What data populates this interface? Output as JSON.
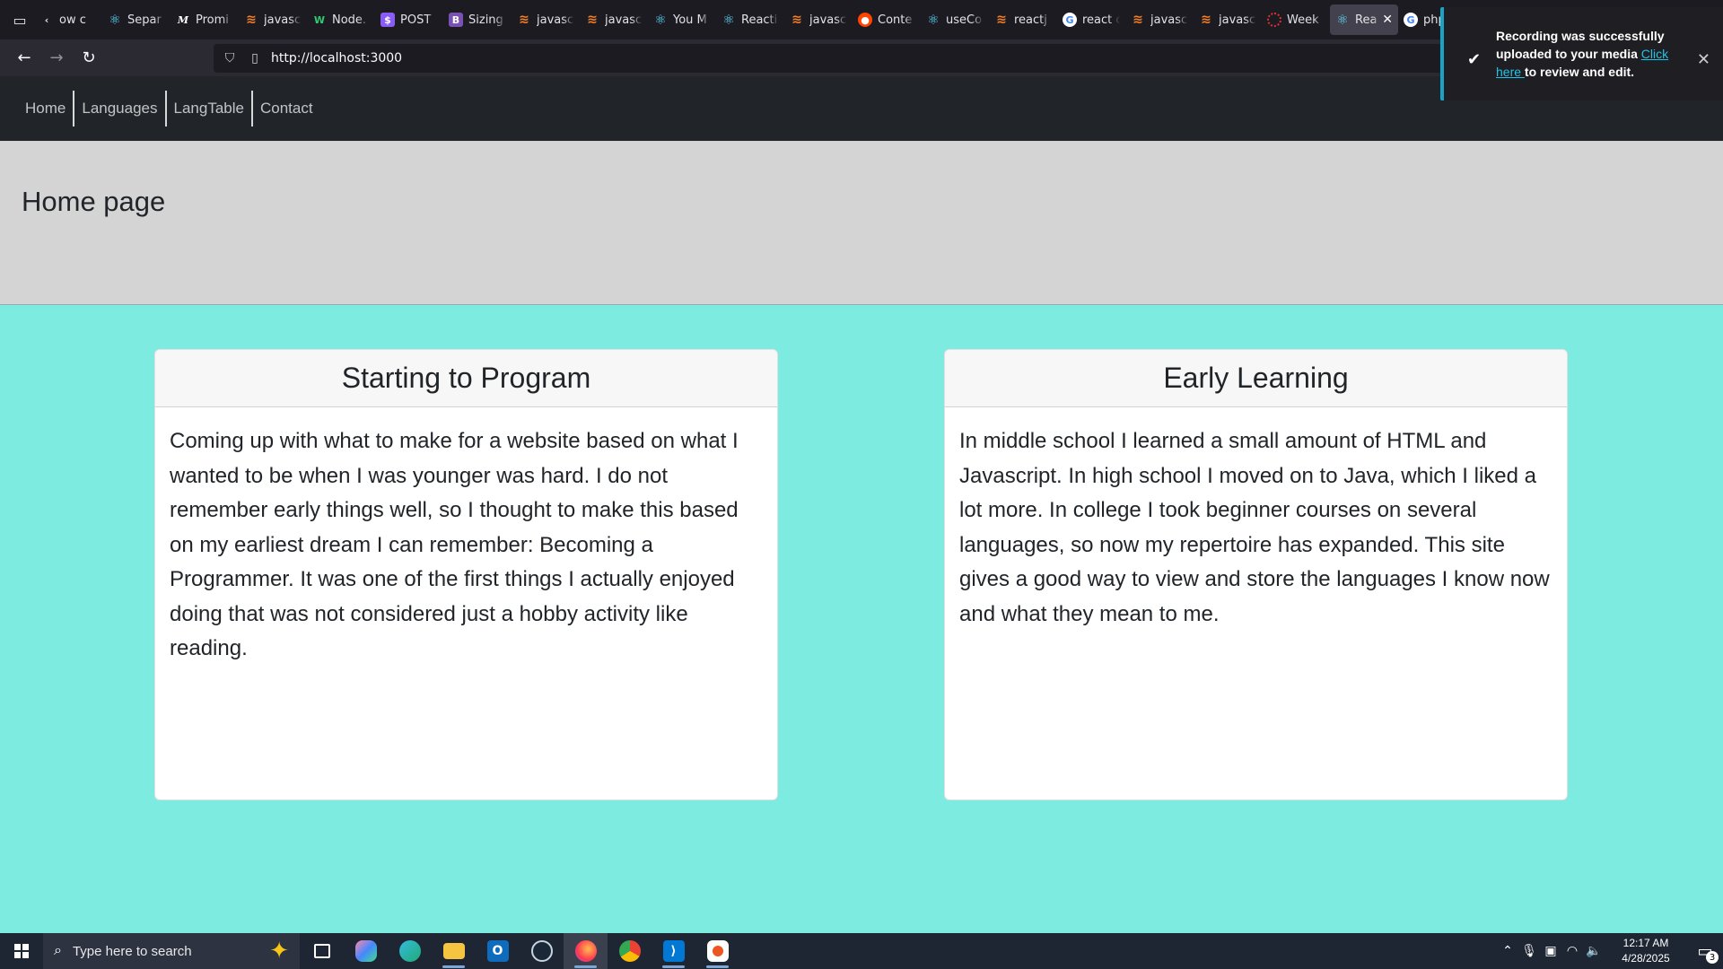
{
  "browser": {
    "tabs": [
      {
        "fav": "‹",
        "favclass": "",
        "title": "ow c"
      },
      {
        "fav": "⚛",
        "favclass": "fav-react",
        "title": "Separ"
      },
      {
        "fav": "M",
        "favclass": "fav-m",
        "title": "Promi"
      },
      {
        "fav": "≋",
        "favclass": "fav-so",
        "title": "javasc"
      },
      {
        "fav": "W",
        "favclass": "fav-w",
        "title": "Node."
      },
      {
        "fav": "$",
        "favclass": "fav-s",
        "title": "POST"
      },
      {
        "fav": "B",
        "favclass": "fav-b",
        "title": "Sizing"
      },
      {
        "fav": "≋",
        "favclass": "fav-so",
        "title": "javasc"
      },
      {
        "fav": "≋",
        "favclass": "fav-so",
        "title": "javasc"
      },
      {
        "fav": "⚛",
        "favclass": "fav-react",
        "title": "You M"
      },
      {
        "fav": "⚛",
        "favclass": "fav-react",
        "title": "Reacti"
      },
      {
        "fav": "≋",
        "favclass": "fav-so",
        "title": "javasc"
      },
      {
        "fav": "●",
        "favclass": "fav-r",
        "title": "Conte"
      },
      {
        "fav": "⚛",
        "favclass": "fav-react",
        "title": "useCo"
      },
      {
        "fav": "≋",
        "favclass": "fav-so",
        "title": "reactj"
      },
      {
        "fav": "G",
        "favclass": "fav-g",
        "title": "react c"
      },
      {
        "fav": "≋",
        "favclass": "fav-so",
        "title": "javasc"
      },
      {
        "fav": "≋",
        "favclass": "fav-so",
        "title": "javasc"
      },
      {
        "fav": "",
        "favclass": "fav-ring",
        "title": "Week"
      },
      {
        "fav": "⚛",
        "favclass": "fav-react",
        "title": "Rea",
        "active": true
      },
      {
        "fav": "G",
        "favclass": "fav-g",
        "title": "php"
      }
    ],
    "active_tab_close": "✕",
    "url": "http://localhost:3000"
  },
  "site": {
    "nav": [
      "Home",
      "Languages",
      "LangTable",
      "Contact"
    ],
    "page_title": "Home page",
    "cards": [
      {
        "title": "Starting to Program",
        "body": "Coming up with what to make for a website based on what I wanted to be when I was younger was hard. I do not remember early things well, so I thought to make this based on my earliest dream I can remember: Becoming a Programmer. It was one of the first things I actually enjoyed doing that was not considered just a hobby activity like reading."
      },
      {
        "title": "Early Learning",
        "body": "In middle school I learned a small amount of HTML and Javascript. In high school I moved on to Java, which I liked a lot more. In college I took beginner courses on several languages, so now my repertoire has expanded. This site gives a good way to view and store the languages I know now and what they mean to me."
      }
    ]
  },
  "toast": {
    "message_a": "Recording was successfully uploaded to your media ",
    "link": "Click here ",
    "message_b": "to review and edit."
  },
  "taskbar": {
    "search_placeholder": "Type here to search",
    "time": "12:17 AM",
    "date": "4/28/2025",
    "notification_count": "3"
  },
  "colors": {
    "page_bg": "#7eebe0",
    "header_bg": "#d4d4d4",
    "navbar_bg": "#212529",
    "toast_accent": "#1aa3c4"
  }
}
